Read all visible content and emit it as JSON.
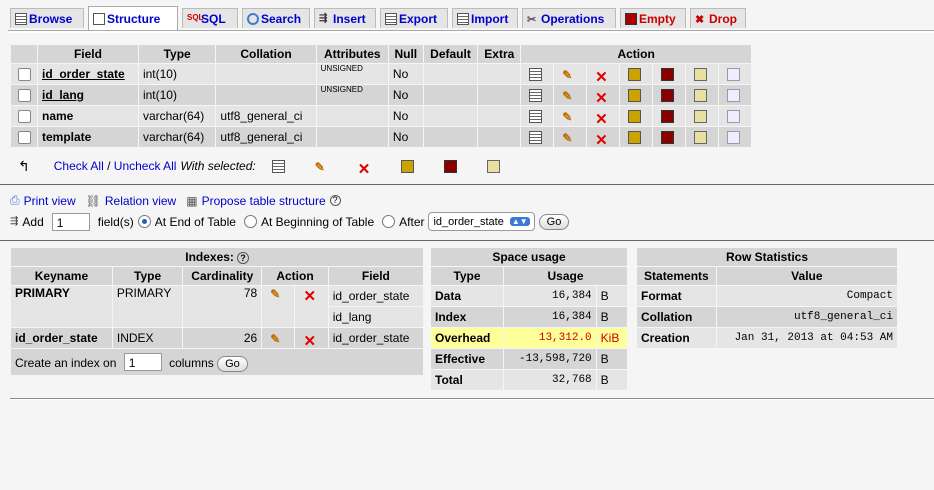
{
  "tabs": [
    {
      "label": "Browse",
      "icon": "browse-icon",
      "active": false
    },
    {
      "label": "Structure",
      "icon": "structure-icon",
      "active": true
    },
    {
      "label": "SQL",
      "icon": "sql-icon",
      "active": false
    },
    {
      "label": "Search",
      "icon": "search-icon",
      "active": false
    },
    {
      "label": "Insert",
      "icon": "insert-icon",
      "active": false
    },
    {
      "label": "Export",
      "icon": "export-icon",
      "active": false
    },
    {
      "label": "Import",
      "icon": "import-icon",
      "active": false
    },
    {
      "label": "Operations",
      "icon": "operations-icon",
      "active": false
    },
    {
      "label": "Empty",
      "icon": "empty-icon",
      "active": false
    },
    {
      "label": "Drop",
      "icon": "drop-icon",
      "active": false
    }
  ],
  "structure": {
    "headers": {
      "field": "Field",
      "type": "Type",
      "collation": "Collation",
      "attributes": "Attributes",
      "null": "Null",
      "default": "Default",
      "extra": "Extra",
      "action": "Action"
    },
    "rows": [
      {
        "field": "id_order_state",
        "type": "int(10)",
        "collation": "",
        "attributes": "UNSIGNED",
        "null": "No",
        "default": "",
        "extra": ""
      },
      {
        "field": "id_lang",
        "type": "int(10)",
        "collation": "",
        "attributes": "UNSIGNED",
        "null": "No",
        "default": "",
        "extra": ""
      },
      {
        "field": "name",
        "type": "varchar(64)",
        "collation": "utf8_general_ci",
        "attributes": "",
        "null": "No",
        "default": "",
        "extra": ""
      },
      {
        "field": "template",
        "type": "varchar(64)",
        "collation": "utf8_general_ci",
        "attributes": "",
        "null": "No",
        "default": "",
        "extra": ""
      }
    ]
  },
  "with_selected": {
    "check_all": "Check All",
    "separator": " / ",
    "uncheck_all": "Uncheck All",
    "label": "With selected:"
  },
  "links": {
    "print_view": "Print view",
    "relation_view": "Relation view",
    "propose": "Propose table structure"
  },
  "add_field": {
    "label": "Add",
    "count": "1",
    "fields_label": "field(s)",
    "end": "At End of Table",
    "beginning": "At Beginning of Table",
    "after": "After",
    "after_value": "id_order_state",
    "go": "Go"
  },
  "indexes": {
    "title": "Indexes:",
    "headers": {
      "keyname": "Keyname",
      "type": "Type",
      "cardinality": "Cardinality",
      "action": "Action",
      "field": "Field"
    },
    "rows": [
      {
        "keyname": "PRIMARY",
        "type": "PRIMARY",
        "cardinality": "78",
        "field1": "id_order_state",
        "field2": "id_lang"
      },
      {
        "keyname": "id_order_state",
        "type": "INDEX",
        "cardinality": "26",
        "field1": "id_order_state"
      }
    ],
    "create_label": "Create an index on",
    "create_count": "1",
    "columns_label": "columns",
    "go": "Go"
  },
  "space": {
    "title": "Space usage",
    "headers": {
      "type": "Type",
      "usage": "Usage"
    },
    "rows": [
      {
        "type": "Data",
        "value": "16,384",
        "unit": "B"
      },
      {
        "type": "Index",
        "value": "16,384",
        "unit": "B"
      },
      {
        "type": "Overhead",
        "value": "13,312.0",
        "unit": "KiB"
      },
      {
        "type": "Effective",
        "value": "-13,598,720",
        "unit": "B"
      },
      {
        "type": "Total",
        "value": "32,768",
        "unit": "B"
      }
    ]
  },
  "rowstats": {
    "title": "Row Statistics",
    "headers": {
      "statements": "Statements",
      "value": "Value"
    },
    "rows": [
      {
        "statement": "Format",
        "value": "Compact"
      },
      {
        "statement": "Collation",
        "value": "utf8_general_ci"
      },
      {
        "statement": "Creation",
        "value": "Jan 31, 2013 at 04:53 AM"
      }
    ]
  },
  "colors": {
    "link": "#0000cc",
    "drop": "#cc0000",
    "overhead_bg": "#ffff99"
  }
}
